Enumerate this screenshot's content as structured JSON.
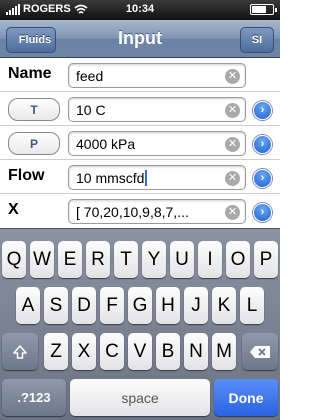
{
  "status_bar": {
    "carrier": "ROGERS",
    "time": "10:34"
  },
  "nav": {
    "title": "Input",
    "back_label": "Fluids",
    "right_label": "SI"
  },
  "rows": [
    {
      "label": "Name",
      "value": "feed",
      "style": "text"
    },
    {
      "label": "T",
      "value": "10 C",
      "style": "pill"
    },
    {
      "label": "P",
      "value": "4000 kPa",
      "style": "pill"
    },
    {
      "label": "Flow",
      "value": "10 mmscfd",
      "style": "text"
    },
    {
      "label": "X",
      "value": "[ 70,20,10,9,8,7,...",
      "style": "text"
    }
  ],
  "keyboard": {
    "row1": [
      "Q",
      "W",
      "E",
      "R",
      "T",
      "Y",
      "U",
      "I",
      "O",
      "P"
    ],
    "row2": [
      "A",
      "S",
      "D",
      "F",
      "G",
      "H",
      "J",
      "K",
      "L"
    ],
    "row3": [
      "Z",
      "X",
      "C",
      "V",
      "B",
      "N",
      "M"
    ],
    "numbers_label": ".?123",
    "space_label": "space",
    "done_label": "Done"
  },
  "colors": {
    "nav_blue": "#6d84a6",
    "done_blue": "#2963e3",
    "detail_blue": "#1f61d6"
  }
}
